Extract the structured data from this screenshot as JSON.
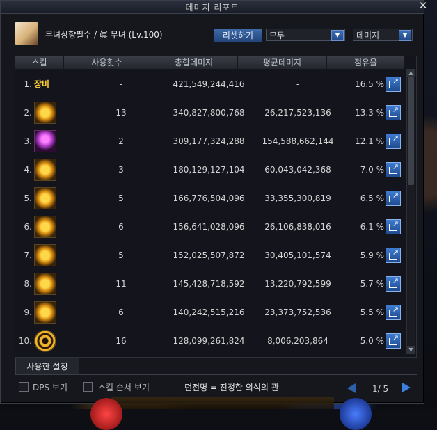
{
  "window": {
    "title": "데미지 리포트",
    "close": "✕"
  },
  "character": {
    "name": "무녀상향필수 / 眞 무녀 (Lv.100)"
  },
  "controls": {
    "reset_label": "리셋하기",
    "filter1": "모두",
    "filter2": "데미지",
    "arrow": "▼"
  },
  "table": {
    "headers": [
      "스킬",
      "사용횟수",
      "총합데미지",
      "평균데미지",
      "점유율"
    ],
    "rows": [
      {
        "num": "1.",
        "skill_text": "장비",
        "uses": "-",
        "total": "421,549,244,416",
        "avg": "-",
        "share": "16.5 %"
      },
      {
        "num": "2.",
        "skill_text": "",
        "uses": "13",
        "total": "340,827,800,768",
        "avg": "26,217,523,136",
        "share": "13.3 %"
      },
      {
        "num": "3.",
        "skill_text": "",
        "uses": "2",
        "total": "309,177,324,288",
        "avg": "154,588,662,144",
        "share": "12.1 %"
      },
      {
        "num": "4.",
        "skill_text": "",
        "uses": "3",
        "total": "180,129,127,104",
        "avg": "60,043,042,368",
        "share": "7.0 %"
      },
      {
        "num": "5.",
        "skill_text": "",
        "uses": "5",
        "total": "166,776,504,096",
        "avg": "33,355,300,819",
        "share": "6.5 %"
      },
      {
        "num": "6.",
        "skill_text": "",
        "uses": "6",
        "total": "156,641,028,096",
        "avg": "26,106,838,016",
        "share": "6.1 %"
      },
      {
        "num": "7.",
        "skill_text": "",
        "uses": "5",
        "total": "152,025,507,872",
        "avg": "30,405,101,574",
        "share": "5.9 %"
      },
      {
        "num": "8.",
        "skill_text": "",
        "uses": "11",
        "total": "145,428,718,592",
        "avg": "13,220,792,599",
        "share": "5.7 %"
      },
      {
        "num": "9.",
        "skill_text": "",
        "uses": "6",
        "total": "140,242,515,216",
        "avg": "23,373,752,536",
        "share": "5.5 %"
      },
      {
        "num": "10.",
        "skill_text": "",
        "uses": "16",
        "total": "128,099,261,824",
        "avg": "8,006,203,864",
        "share": "5.0 %"
      }
    ]
  },
  "footer": {
    "used_settings_tab": "사용한 설정",
    "dps_label": "DPS 보기",
    "skill_order_label": "스킬 순서 보기",
    "dungeon": "던전명 = 진정한 의식의 관",
    "page": "1/ 5"
  }
}
